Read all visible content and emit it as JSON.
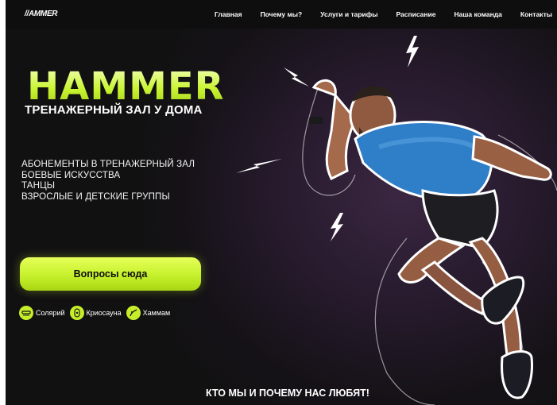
{
  "brand": {
    "logo_text": "//AMMER"
  },
  "nav": {
    "items": [
      "Главная",
      "Почему мы?",
      "Услуги и тарифы",
      "Расписание",
      "Наша команда",
      "Контакты"
    ]
  },
  "hero": {
    "title": "HAMMER",
    "subtitle": "ТРЕНАЖЕРНЫЙ ЗАЛ У ДОМА",
    "services": [
      "АБОНЕМЕНТЫ В ТРЕНАЖЕРНЫЙ ЗАЛ",
      "БОЕВЫЕ ИСКУССТВА",
      "ТАНЦЫ",
      "ВЗРОСЛЫЕ И ДЕТСКИЕ ГРУППЫ"
    ],
    "cta_label": "Вопросы сюда",
    "features": [
      {
        "label": "Солярий",
        "icon": "solarium-icon"
      },
      {
        "label": "Криосауна",
        "icon": "cryosauna-icon"
      },
      {
        "label": "Хаммам",
        "icon": "hammam-icon"
      }
    ]
  },
  "section": {
    "bottom_title": "КТО МЫ И ПОЧЕМУ НАС ЛЮБЯТ!"
  },
  "colors": {
    "accent": "#c6ee2a",
    "background": "#121112",
    "header": "#0e0e0e"
  }
}
